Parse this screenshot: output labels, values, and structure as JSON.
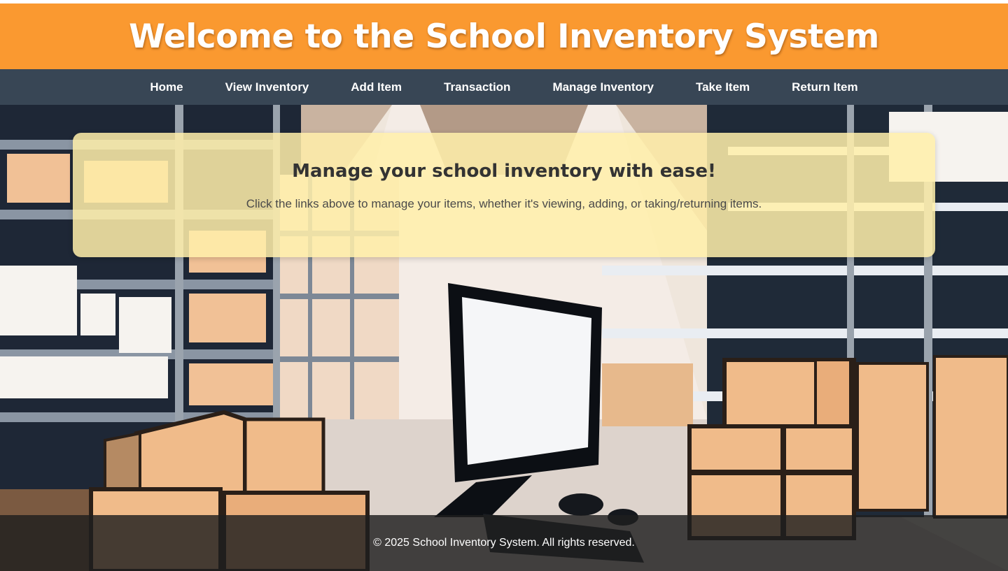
{
  "header": {
    "title": "Welcome to the School Inventory System"
  },
  "nav": {
    "items": [
      {
        "label": "Home"
      },
      {
        "label": "View Inventory"
      },
      {
        "label": "Add Item"
      },
      {
        "label": "Transaction"
      },
      {
        "label": "Manage Inventory"
      },
      {
        "label": "Take Item"
      },
      {
        "label": "Return Item"
      }
    ]
  },
  "intro": {
    "heading": "Manage your school inventory with ease!",
    "text": "Click the links above to manage your items, whether it's viewing, adding, or taking/returning items."
  },
  "footer": {
    "text": "© 2025 School Inventory System. All rights reserved."
  },
  "colors": {
    "header_bg": "#fb8c14",
    "nav_bg": "#233446",
    "card_bg": "#ffefaa",
    "footer_bg": "#1e1e1e"
  },
  "background": {
    "icon": "warehouse-illustration"
  }
}
